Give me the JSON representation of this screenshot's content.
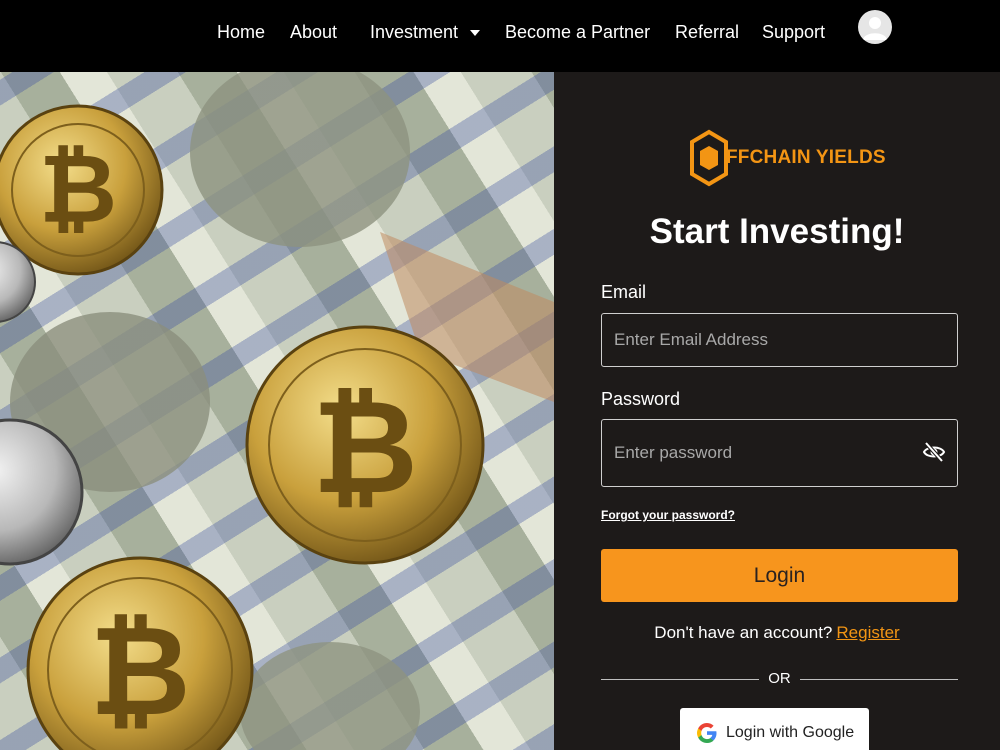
{
  "nav": {
    "items": [
      {
        "label": "Home"
      },
      {
        "label": "About"
      },
      {
        "label": "Investment"
      },
      {
        "label": "Become a Partner"
      },
      {
        "label": "Referral"
      },
      {
        "label": "Support"
      }
    ]
  },
  "brand": {
    "name": "FFCHAIN YIELDS",
    "color": "#f39514"
  },
  "form": {
    "heading": "Start Investing!",
    "email_label": "Email",
    "email_placeholder": "Enter Email Address",
    "password_label": "Password",
    "password_placeholder": "Enter password",
    "forgot": "Forgot your password?",
    "login_button": "Login",
    "no_account": "Don't have an account?",
    "register": "Register",
    "or": "OR",
    "google_button": "Login with Google"
  },
  "colors": {
    "accent": "#f7951d",
    "panel": "#1d1a19",
    "nav": "#000000"
  }
}
